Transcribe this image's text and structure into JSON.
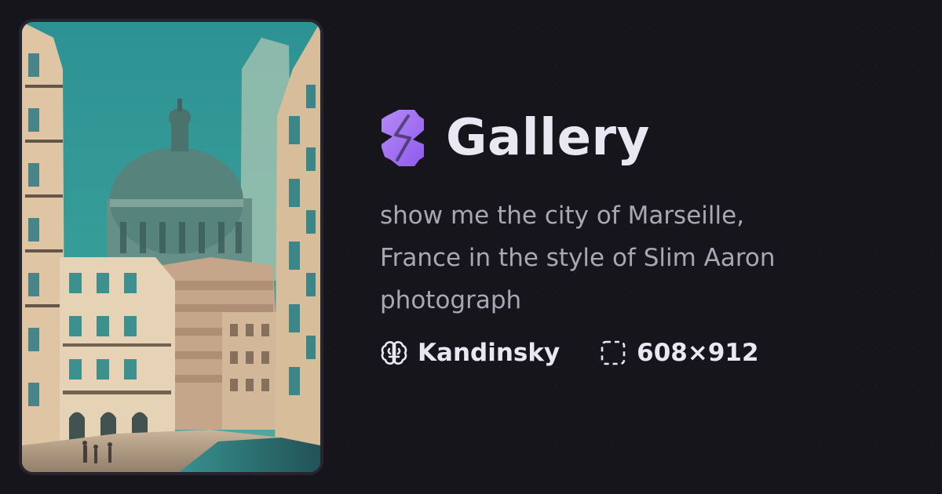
{
  "header": {
    "title": "Gallery",
    "logo_icon": "gallery-logo-icon",
    "accent": "#a773f4"
  },
  "artwork": {
    "description_image": "generated-image-thumbnail"
  },
  "prompt": {
    "text": "show me the city of Marseille, France in the style of Slim Aaron photograph"
  },
  "meta": {
    "model_icon": "brain-icon",
    "model": "Kandinsky",
    "size_icon": "dashed-square-icon",
    "dimensions": "608×912"
  },
  "colors": {
    "background": "#16151b",
    "title": "#e9e7f1",
    "prompt": "#a9a7b3"
  }
}
